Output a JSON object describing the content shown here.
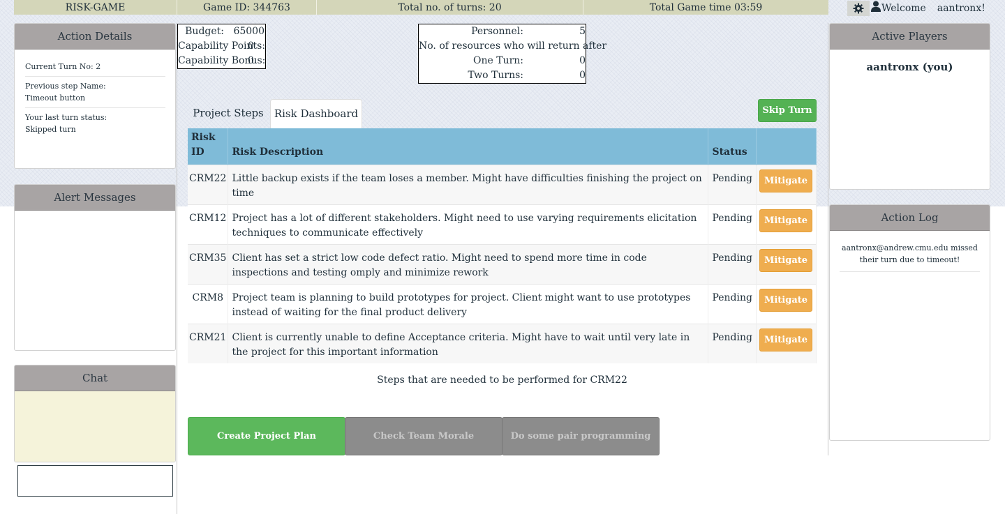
{
  "topbar": {
    "title": "RISK-GAME",
    "game_id": "Game ID: 344763",
    "total_turns": "Total no. of turns: 20",
    "game_time": "Total Game time 03:59",
    "welcome": "Welcome",
    "username": "aantronx!",
    "settings_icon": "gear-icon",
    "user_icon": "user-icon"
  },
  "action_details": {
    "title": "Action Details",
    "current_turn": "Current Turn No: 2",
    "previous_step_label": "Previous step Name:",
    "previous_step_value": "Timeout button",
    "last_status_label": "Your last turn status:",
    "last_status_value": "Skipped turn"
  },
  "alert_messages": {
    "title": "Alert Messages"
  },
  "chat": {
    "title": "Chat",
    "input_value": ""
  },
  "budget": {
    "budget_label": "Budget:",
    "budget_value": "65000",
    "cap_points_label": "Capability Points:",
    "cap_points_value": "0",
    "cap_bonus_label": "Capability Bonus:",
    "cap_bonus_value": "0"
  },
  "personnel": {
    "personnel_label": "Personnel:",
    "personnel_value": "5",
    "return_label": "No. of resources who will return after",
    "one_turn_label": "One Turn:",
    "one_turn_value": "0",
    "two_turns_label": "Two Turns:",
    "two_turns_value": "0"
  },
  "tabs": {
    "steps": "Project Steps",
    "risk": "Risk Dashboard"
  },
  "skip_turn_label": "Skip Turn",
  "risk_table": {
    "headers": {
      "id": "Risk ID",
      "description": "Risk Description",
      "status": "Status"
    },
    "mitigate_label": "Mitigate",
    "rows": [
      {
        "id": "CRM22",
        "description": "Little backup exists if the team loses a member. Might have difficulties finishing the project on time",
        "status": "Pending"
      },
      {
        "id": "CRM12",
        "description": "Project has a lot of different stakeholders. Might need to use varying requirements elicitation techniques to communicate effectively",
        "status": "Pending"
      },
      {
        "id": "CRM35",
        "description": "Client has set a strict low code defect ratio. Might need to spend more time in code inspections and testing omply and minimize rework",
        "status": "Pending"
      },
      {
        "id": "CRM8",
        "description": "Project team is planning to build prototypes for project. Client might want to use prototypes instead of waiting for the final product delivery",
        "status": "Pending"
      },
      {
        "id": "CRM21",
        "description": "Client is currently unable to define Acceptance criteria. Might have to wait until very late in the project for this important information",
        "status": "Pending"
      }
    ]
  },
  "steps": {
    "label": "Steps that are needed to be performed for CRM22",
    "buttons": [
      "Create Project Plan",
      "Check Team Morale",
      "Do some pair programming"
    ]
  },
  "active_players": {
    "title": "Active Players",
    "player": "aantronx (you)"
  },
  "action_log": {
    "title": "Action Log",
    "entries": [
      "aantronx@andrew.cmu.edu missed their turn due to timeout!"
    ]
  },
  "colors": {
    "topbar_bg": "#d4d6b9",
    "panel_header": "#a8a4a4",
    "table_header": "#7fbbd8",
    "mitigate": "#efad4f",
    "skip_turn": "#54b254",
    "step_active": "#5cb85c",
    "step_disabled": "#8c8c8c",
    "chat_bg": "#f5f3da"
  }
}
